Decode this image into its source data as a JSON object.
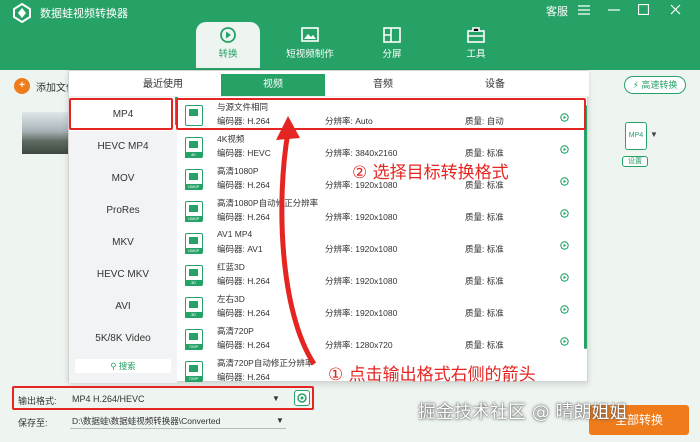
{
  "app": {
    "title": "数据蛙视频转换器",
    "support_label": "客服",
    "menu_icon": "hamburger-icon",
    "minimize_icon": "minimize-icon",
    "maximize_icon": "maximize-icon",
    "close_icon": "close-icon",
    "accent_color": "#27a267",
    "orange_color": "#ef7b1a",
    "annotation_color": "#e52521"
  },
  "tabs": [
    {
      "label": "转换",
      "icon": "convert-icon",
      "active": true
    },
    {
      "label": "短视频制作",
      "icon": "image-icon",
      "active": false
    },
    {
      "label": "分屏",
      "icon": "split-screen-icon",
      "active": false
    },
    {
      "label": "工具",
      "icon": "toolbox-icon",
      "active": false
    }
  ],
  "toolbar": {
    "add_file_label": "添加文件",
    "high_speed_label": "高速转换",
    "file_format_badge": "MP4",
    "settings_label": "设置"
  },
  "popup": {
    "tabs": [
      {
        "label": "最近使用",
        "active": false
      },
      {
        "label": "视频",
        "active": true
      },
      {
        "label": "音频",
        "active": false
      },
      {
        "label": "设备",
        "active": false
      }
    ],
    "formats": [
      {
        "label": "MP4",
        "active": true
      },
      {
        "label": "HEVC MP4",
        "active": false
      },
      {
        "label": "MOV",
        "active": false
      },
      {
        "label": "ProRes",
        "active": false
      },
      {
        "label": "MKV",
        "active": false
      },
      {
        "label": "HEVC MKV",
        "active": false
      },
      {
        "label": "AVI",
        "active": false
      },
      {
        "label": "5K/8K Video",
        "active": false
      }
    ],
    "search_label": "搜索",
    "presets": [
      {
        "name": "与源文件相同",
        "codec": "编码器:   H.264",
        "resolution": "分辨率:   Auto",
        "quality": "质量:   自动",
        "tag": ""
      },
      {
        "name": "4K视频",
        "codec": "编码器:   HEVC",
        "resolution": "分辨率:   3840x2160",
        "quality": "质量:   标准",
        "tag": "4K"
      },
      {
        "name": "高清1080P",
        "codec": "编码器:   H.264",
        "resolution": "分辨率:   1920x1080",
        "quality": "质量:   标准",
        "tag": "1080P"
      },
      {
        "name": "高清1080P自动修正分辨率",
        "codec": "编码器:   H.264",
        "resolution": "分辨率:   1920x1080",
        "quality": "质量:   标准",
        "tag": "1080P"
      },
      {
        "name": "AV1 MP4",
        "codec": "编码器:   AV1",
        "resolution": "分辨率:   1920x1080",
        "quality": "质量:   标准",
        "tag": "1080P"
      },
      {
        "name": "红蓝3D",
        "codec": "编码器:   H.264",
        "resolution": "分辨率:   1920x1080",
        "quality": "质量:   标准",
        "tag": "3D"
      },
      {
        "name": "左右3D",
        "codec": "编码器:   H.264",
        "resolution": "分辨率:   1920x1080",
        "quality": "质量:   标准",
        "tag": "3D"
      },
      {
        "name": "高清720P",
        "codec": "编码器:   H.264",
        "resolution": "分辨率:   1280x720",
        "quality": "质量:   标准",
        "tag": "720P"
      },
      {
        "name": "高清720P自动修正分辨率",
        "codec": "编码器:   H.264",
        "resolution": "",
        "quality": "",
        "tag": "720P"
      }
    ]
  },
  "output": {
    "format_label": "输出格式:",
    "format_value": "MP4 H.264/HEVC",
    "save_label": "保存至:",
    "save_path": "D:\\数据蛙\\数据蛙视频转换器\\Converted",
    "convert_label": "全部转换"
  },
  "annotations": {
    "step1": "① 点击输出格式右侧的箭头",
    "step2": "② 选择目标转换格式"
  },
  "watermark": "掘金技术社区 @ 晴朗姐姐"
}
